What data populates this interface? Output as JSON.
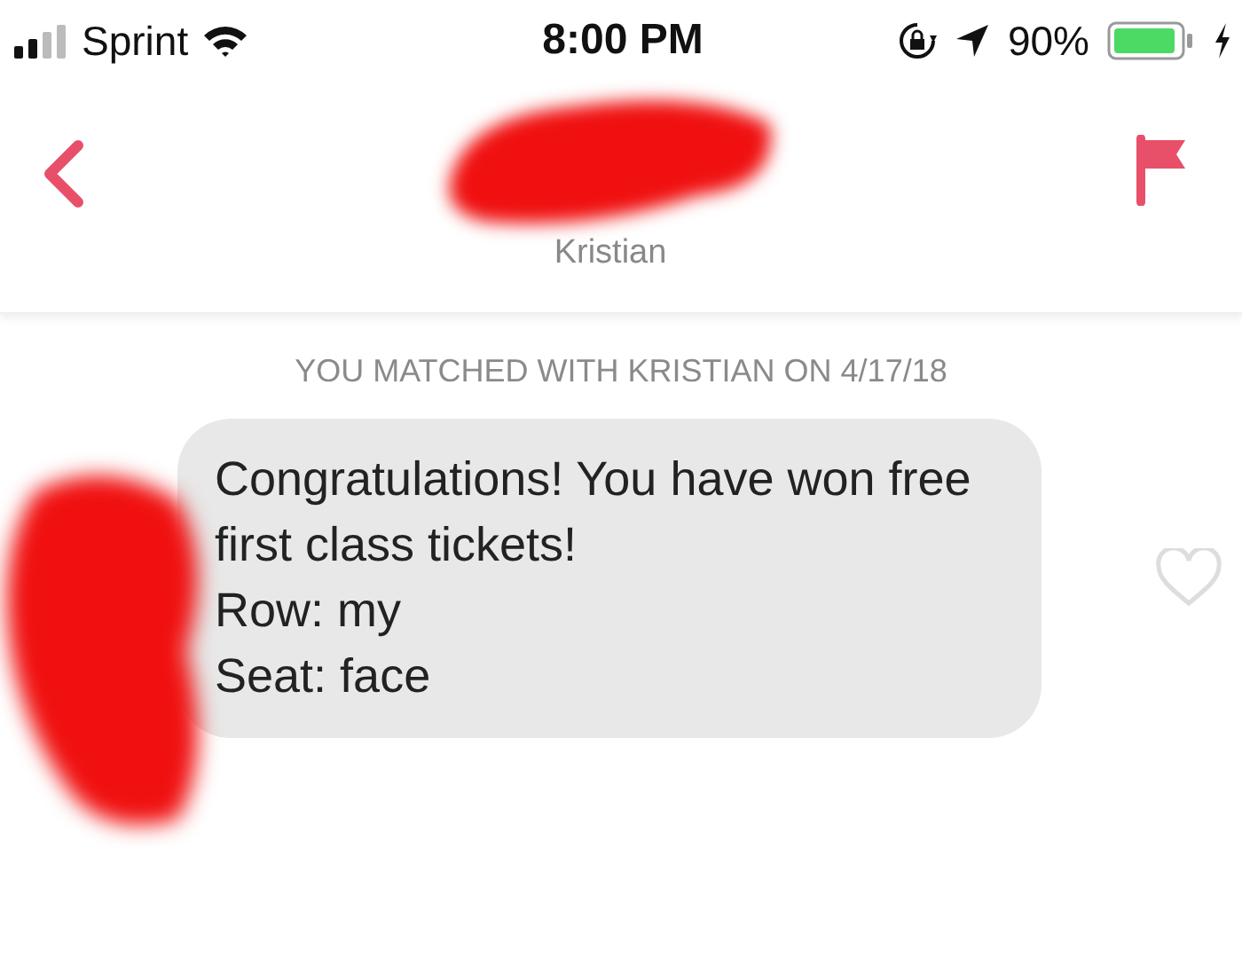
{
  "status_bar": {
    "carrier": "Sprint",
    "time": "8:00 PM",
    "battery": "90%"
  },
  "header": {
    "name": "Kristian"
  },
  "match_notice": "YOU MATCHED WITH KRISTIAN ON 4/17/18",
  "messages": [
    {
      "lines": [
        "Congratulations! You have won free first class tickets!",
        "Row: my",
        "Seat: face"
      ],
      "liked": false
    }
  ]
}
